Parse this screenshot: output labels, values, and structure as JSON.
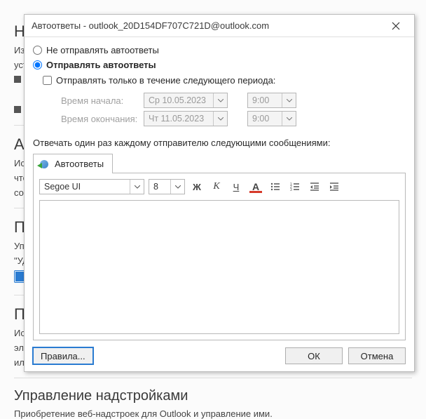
{
  "bg": {
    "h_notify_prefix": "Н",
    "h_auto_prefix": "Ав",
    "h_params_prefix": "Па",
    "h_priv_prefix": "Пр",
    "notif_line1": "Изм",
    "notif_line2": "уста",
    "auto_line1": "Ис",
    "auto_line2": "что",
    "auto_line3": "соо",
    "params_line1": "Упр",
    "params_line2": "\"Уд",
    "priv_line1": "Ис",
    "priv_line2": "элек",
    "priv_line3": "или",
    "addons_heading": "Управление надстройками",
    "addons_sub": "Приобретение веб-надстроек для Outlook и управление ими."
  },
  "dialog": {
    "title": "Автоответы - outlook_20D154DF707C721D@outlook.com",
    "radio_off": "Не отправлять автоответы",
    "radio_on": "Отправлять автоответы",
    "chk_period": "Отправлять только в течение следующего периода:",
    "start_label": "Время начала:",
    "end_label": "Время окончания:",
    "start_date": "Ср 10.05.2023",
    "start_time": "9:00",
    "end_date": "Чт 11.05.2023",
    "end_time": "9:00",
    "reply_text": "Отвечать один раз каждому отправителю следующими сообщениями:",
    "tab_label": "Автоответы",
    "font_name": "Segoe UI",
    "font_size": "8",
    "btn_rules": "Правила...",
    "btn_ok": "ОК",
    "btn_cancel": "Отмена",
    "bold_glyph": "Ж",
    "italic_glyph": "К",
    "underline_glyph": "Ч",
    "color_glyph": "А"
  }
}
